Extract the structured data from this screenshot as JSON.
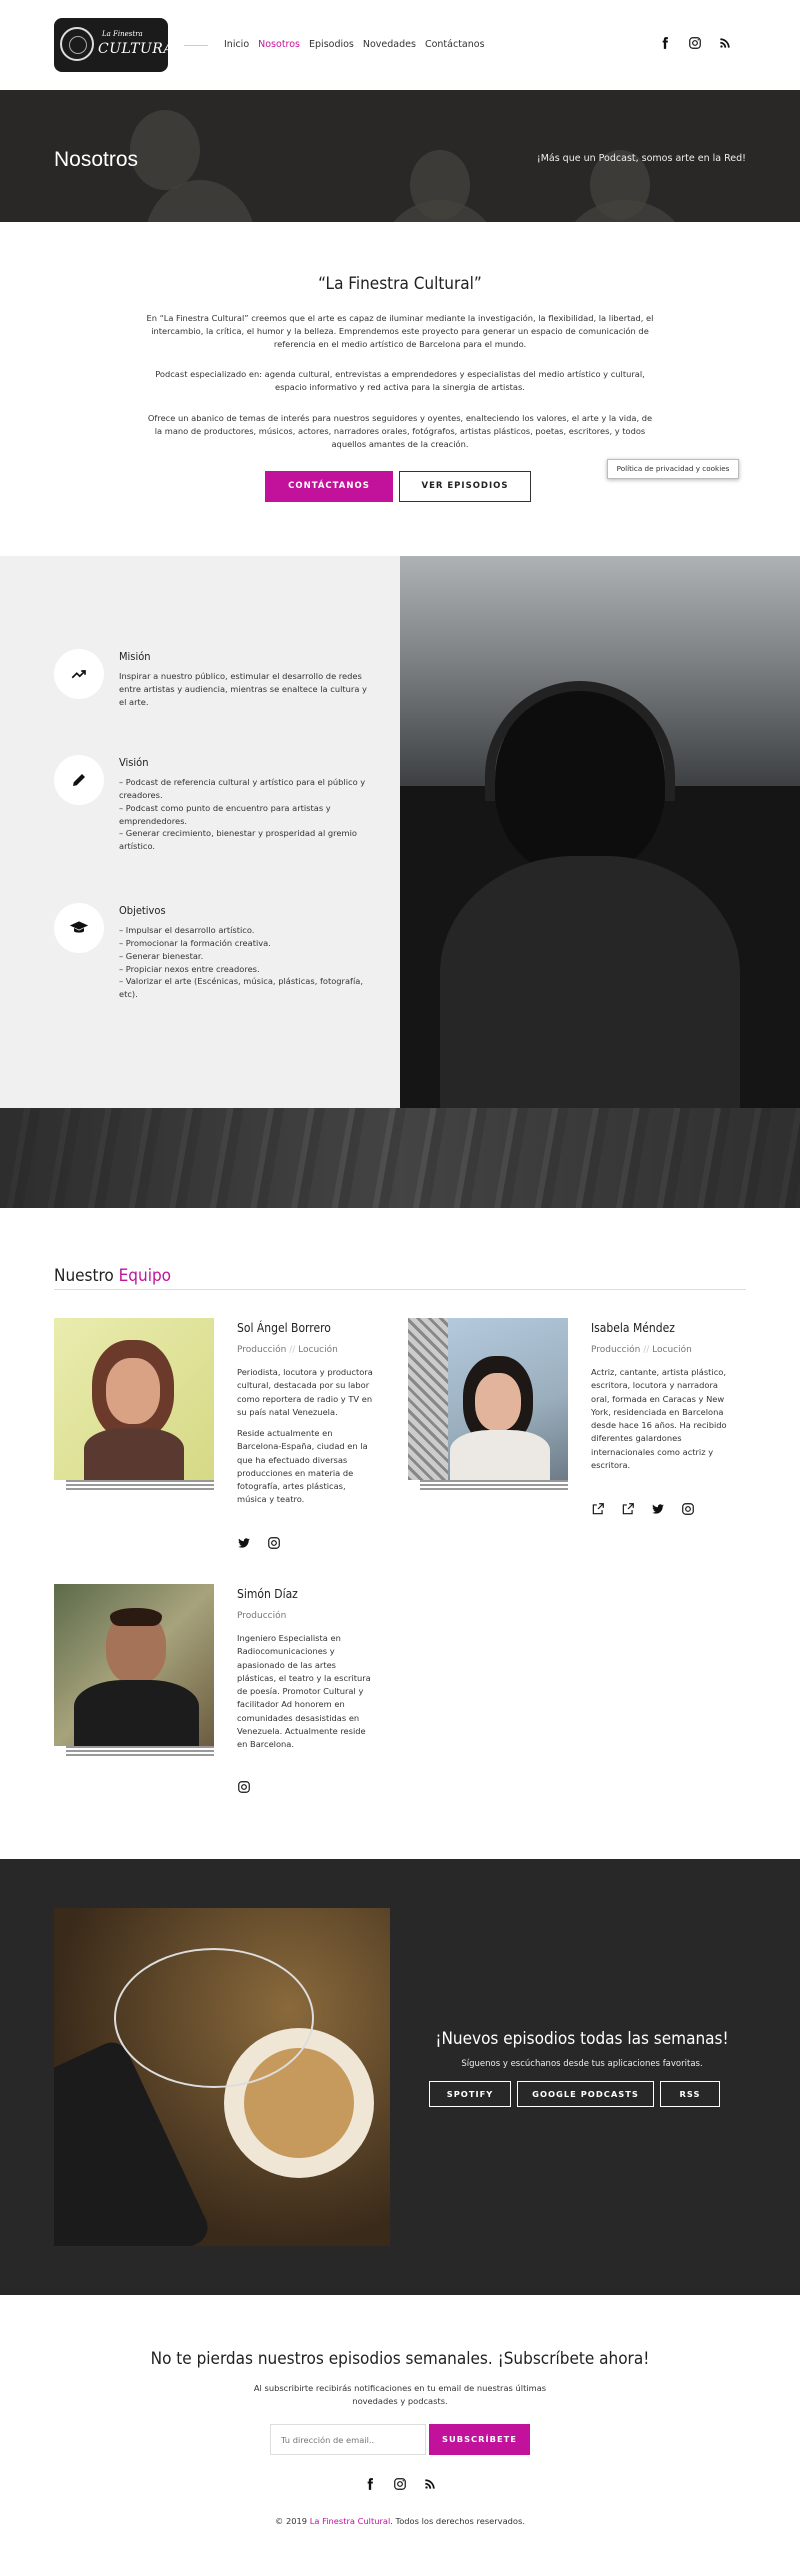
{
  "header": {
    "logo": {
      "top": "La Finestra",
      "main": "CULTURAL"
    },
    "nav": [
      "Inicio",
      "Nosotros",
      "Episodios",
      "Novedades",
      "Contáctanos"
    ],
    "active": "Nosotros",
    "social": [
      "facebook-icon",
      "instagram-icon",
      "rss-icon"
    ]
  },
  "hero": {
    "title": "Nosotros",
    "subtitle": "¡Más que un Podcast, somos arte en la Red!"
  },
  "intro": {
    "title": "“La Finestra Cultural”",
    "paragraphs": [
      "En “La Finestra Cultural” creemos que el arte es capaz de iluminar mediante la investigación, la flexibilidad, la libertad, el intercambio, la crítica, el humor y la belleza. Emprendemos este proyecto para generar un espacio de comunicación de referencia en el medio artístico de Barcelona para el mundo.",
      "Podcast especializado en: agenda cultural, entrevistas a emprendedores y especialistas del medio artístico y cultural, espacio informativo y red activa para la sinergia de artistas.",
      "Ofrece un abanico de temas de interés para nuestros seguidores y oyentes, enalteciendo los valores, el arte y la vida, de la mano de productores, músicos, actores, narradores orales, fotógrafos, artistas plásticos, poetas, escritores, y todos aquellos amantes de la creación."
    ],
    "btn_contact": "CONTÁCTANOS",
    "btn_episodes": "VER EPISODIOS",
    "cookie": "Política de privacidad y cookies"
  },
  "mission": {
    "items": [
      {
        "icon": "trending-up-icon",
        "title": "Misión",
        "text": "Inspirar a nuestro público, estimular el desarrollo de redes entre artistas y audiencia, mientras se enaltece la cultura y el arte."
      },
      {
        "icon": "pencil-icon",
        "title": "Visión",
        "text": "– Podcast de referencia cultural y artístico para el público y creadores.\n– Podcast como punto de encuentro para artistas y emprendedores.\n– Generar crecimiento, bienestar y prosperidad al gremio artístico."
      },
      {
        "icon": "graduation-cap-icon",
        "title": "Objetivos",
        "text": "– Impulsar el desarrollo artístico.\n– Promocionar la formación creativa.\n– Generar bienestar.\n– Propiciar nexos entre creadores.\n– Valorizar el arte (Escénicas, música, plásticas, fotografía, etc)."
      }
    ]
  },
  "team": {
    "title_a": "Nuestro ",
    "title_b": "Equipo",
    "members": [
      {
        "name": "Sol Ángel Borrero",
        "roles": [
          "Producción",
          "Locución"
        ],
        "desc": [
          "Periodista, locutora y productora cultural, destacada por su labor como reportera de radio y TV en su país natal Venezuela.",
          "Reside actualmente en Barcelona-España, ciudad en la que ha efectuado diversas producciones en materia de fotografía, artes plásticas, música y teatro."
        ]
      },
      {
        "name": "Isabela Méndez",
        "roles": [
          "Producción",
          "Locución"
        ],
        "desc": [
          "Actriz, cantante, artista plástico, escritora, locutora y narradora oral, formada en Caracas y New York, residenciada en Barcelona desde hace 16 años. Ha recibido diferentes galardones internacionales como actriz y escritora."
        ]
      },
      {
        "name": "Simón Díaz",
        "roles": [
          "Producción"
        ],
        "desc": [
          "Ingeniero Especialista en Radiocomunicaciones y apasionado de las artes plásticas, el teatro y la escritura de poesía. Promotor Cultural y facilitador Ad honorem en comunidades desasistidas en Venezuela. Actualmente reside en Barcelona."
        ]
      }
    ]
  },
  "podcast": {
    "title": "¡Nuevos episodios todas las semanas!",
    "subtitle": "Síguenos y escúchanos desde tus aplicaciones favoritas.",
    "buttons": [
      "SPOTIFY",
      "GOOGLE PODCASTS",
      "RSS"
    ]
  },
  "subscribe": {
    "title": "No te pierdas nuestros episodios semanales. ¡Subscríbete ahora!",
    "text": "Al subscribirte recibirás notificaciones en tu email de nuestras últimas novedades y podcasts.",
    "placeholder": "Tu dirección de email..",
    "button": "SUBSCRÍBETE"
  },
  "footer": {
    "copy_a": "© 2019 ",
    "brand": "La Finestra Cultural",
    "copy_b": ". Todos los derechos reservados."
  },
  "colors": {
    "accent": "#c2129c",
    "dark": "#282828",
    "light": "#f0f0f0"
  }
}
